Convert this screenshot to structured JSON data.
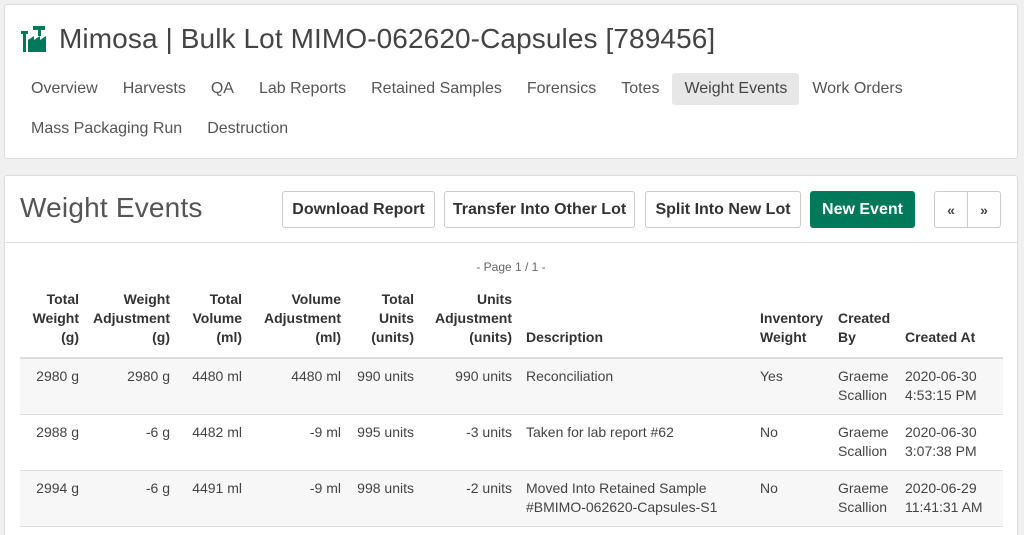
{
  "header": {
    "title": "Mimosa | Bulk Lot MIMO-062620-Capsules [789456]",
    "icon": "factory-icon",
    "accent": "#00795a"
  },
  "tabs": [
    {
      "label": "Overview",
      "active": false
    },
    {
      "label": "Harvests",
      "active": false
    },
    {
      "label": "QA",
      "active": false
    },
    {
      "label": "Lab Reports",
      "active": false
    },
    {
      "label": "Retained Samples",
      "active": false
    },
    {
      "label": "Forensics",
      "active": false
    },
    {
      "label": "Totes",
      "active": false
    },
    {
      "label": "Weight Events",
      "active": true
    },
    {
      "label": "Work Orders",
      "active": false
    },
    {
      "label": "Mass Packaging Run",
      "active": false
    },
    {
      "label": "Destruction",
      "active": false
    }
  ],
  "section": {
    "title": "Weight Events",
    "download_label": "Download Report",
    "transfer_label": "Transfer Into Other Lot",
    "split_label": "Split Into New Lot",
    "new_label": "New Event",
    "prev_label": "«",
    "next_label": "»",
    "page_info": "- Page 1 / 1 -"
  },
  "table": {
    "headers": [
      [
        "Total",
        "Weight",
        "(g)"
      ],
      [
        "Weight",
        "Adjustment",
        "(g)"
      ],
      [
        "Total",
        "Volume",
        "(ml)"
      ],
      [
        "Volume",
        "Adjustment",
        "(ml)"
      ],
      [
        "Total",
        "Units",
        "(units)"
      ],
      [
        "Units",
        "Adjustment",
        "(units)"
      ],
      [
        "Description"
      ],
      [
        "Inventory",
        "Weight"
      ],
      [
        "Created",
        "By"
      ],
      [
        "Created At"
      ]
    ],
    "rows": [
      [
        "2980 g",
        "2980 g",
        "4480 ml",
        "4480 ml",
        "990 units",
        "990 units",
        "Reconciliation",
        "Yes",
        "Graeme Scallion",
        "2020-06-30 4:53:15 PM"
      ],
      [
        "2988 g",
        "-6 g",
        "4482 ml",
        "-9 ml",
        "995 units",
        "-3 units",
        "Taken for lab report #62",
        "No",
        "Graeme Scallion",
        "2020-06-30 3:07:38 PM"
      ],
      [
        "2994 g",
        "-6 g",
        "4491 ml",
        "-9 ml",
        "998 units",
        "-2 units",
        "Moved Into Retained Sample #BMIMO-062620-Capsules-S1",
        "No",
        "Graeme Scallion",
        "2020-06-29 11:41:31 AM"
      ]
    ]
  }
}
